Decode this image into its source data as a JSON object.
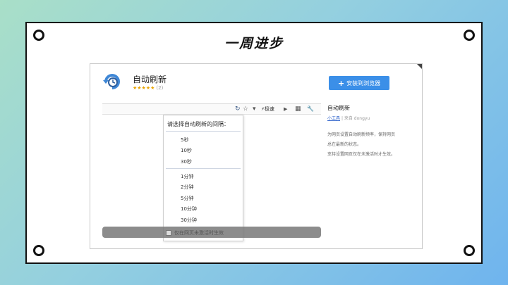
{
  "slide": {
    "title": "一周进步"
  },
  "extension": {
    "name": "自动刷新",
    "stars": "★★★★★",
    "rating_count": "(2)",
    "install_label": "安装到浏览器",
    "install_icon": "plus-icon"
  },
  "toolbar": {
    "refresh_icon": "↻",
    "star_icon": "☆",
    "dropdown_icon": "▾",
    "quick_label": "⚡极速",
    "play_icon": "▶",
    "apps_icon": "▦",
    "tools_icon": "🔧"
  },
  "menu": {
    "header": "请选择自动刷新的间隔：",
    "seconds": [
      "5秒",
      "10秒",
      "30秒"
    ],
    "minutes": [
      "1分钟",
      "2分钟",
      "5分钟",
      "10分钟",
      "30分钟"
    ],
    "checkbox_label": "仅在网页未激活时生效"
  },
  "sidebar": {
    "title": "自动刷新",
    "category": "小工具",
    "author": "来自 dongyu",
    "description": [
      "为网页设置自动刷新频率，保持网页",
      "总在最新的状态。",
      "支持设置网页仅在未激活时才生效。"
    ]
  },
  "colors": {
    "accent": "#3b8fe8",
    "star": "#e8a400",
    "link": "#3366cc"
  }
}
